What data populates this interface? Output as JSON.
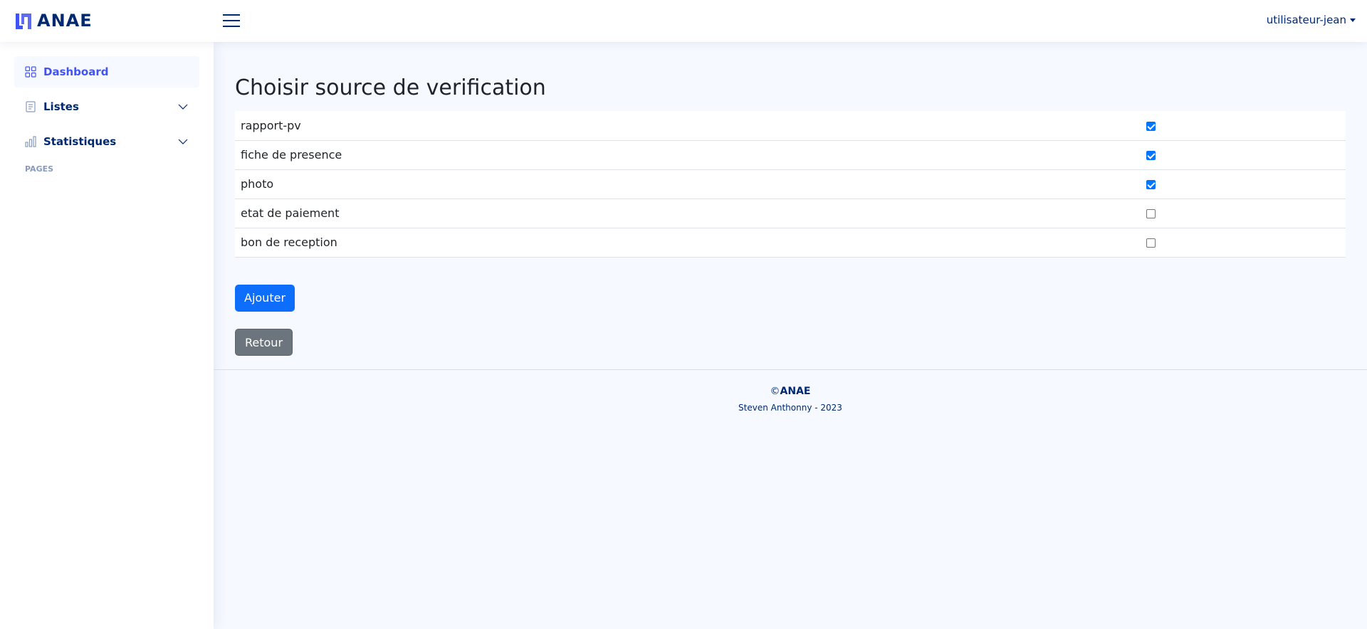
{
  "brand": {
    "name": "ANAE",
    "color": "#4154f1"
  },
  "header": {
    "menu_icon": "hamburger-icon",
    "user": "utilisateur-jean"
  },
  "sidebar": {
    "items": [
      {
        "label": "Dashboard",
        "icon": "grid-icon",
        "active": true
      },
      {
        "label": "Listes",
        "icon": "list-icon",
        "expandable": true
      },
      {
        "label": "Statistiques",
        "icon": "bar-chart-icon",
        "expandable": true
      }
    ],
    "heading": "Pages"
  },
  "main": {
    "title": "Choisir source de verification",
    "sources": [
      {
        "label": "rapport-pv",
        "checked": true
      },
      {
        "label": "fiche de presence",
        "checked": true
      },
      {
        "label": "photo",
        "checked": true
      },
      {
        "label": "etat de paiement",
        "checked": false
      },
      {
        "label": "bon de reception",
        "checked": false
      }
    ],
    "add_label": "Ajouter",
    "back_label": "Retour"
  },
  "footer": {
    "copyright_symbol": "©",
    "copyright_name": "ANAE",
    "credits": "Steven Anthonny - 2023"
  }
}
